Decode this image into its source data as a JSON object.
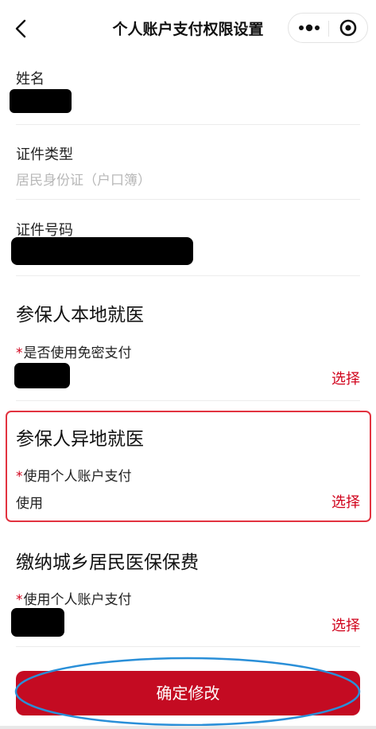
{
  "nav": {
    "title": "个人账户支付权限设置"
  },
  "fields": {
    "name_label": "姓名",
    "id_type_label": "证件类型",
    "id_type_value": "居民身份证（户口簿）",
    "id_number_label": "证件号码"
  },
  "sections": [
    {
      "title": "参保人本地就医",
      "field_label": "是否使用免密支付",
      "value": "",
      "action": "选择"
    },
    {
      "title": "参保人异地就医",
      "field_label": "使用个人账户支付",
      "value": "使用",
      "action": "选择"
    },
    {
      "title": "缴纳城乡居民医保保费",
      "field_label": "使用个人账户支付",
      "value": "",
      "action": "选择"
    }
  ],
  "required_mark": "*",
  "confirm_label": "确定修改",
  "colors": {
    "accent_red": "#c40b22",
    "highlight_red": "#e23340",
    "annotation_blue": "#2a8fd8"
  }
}
